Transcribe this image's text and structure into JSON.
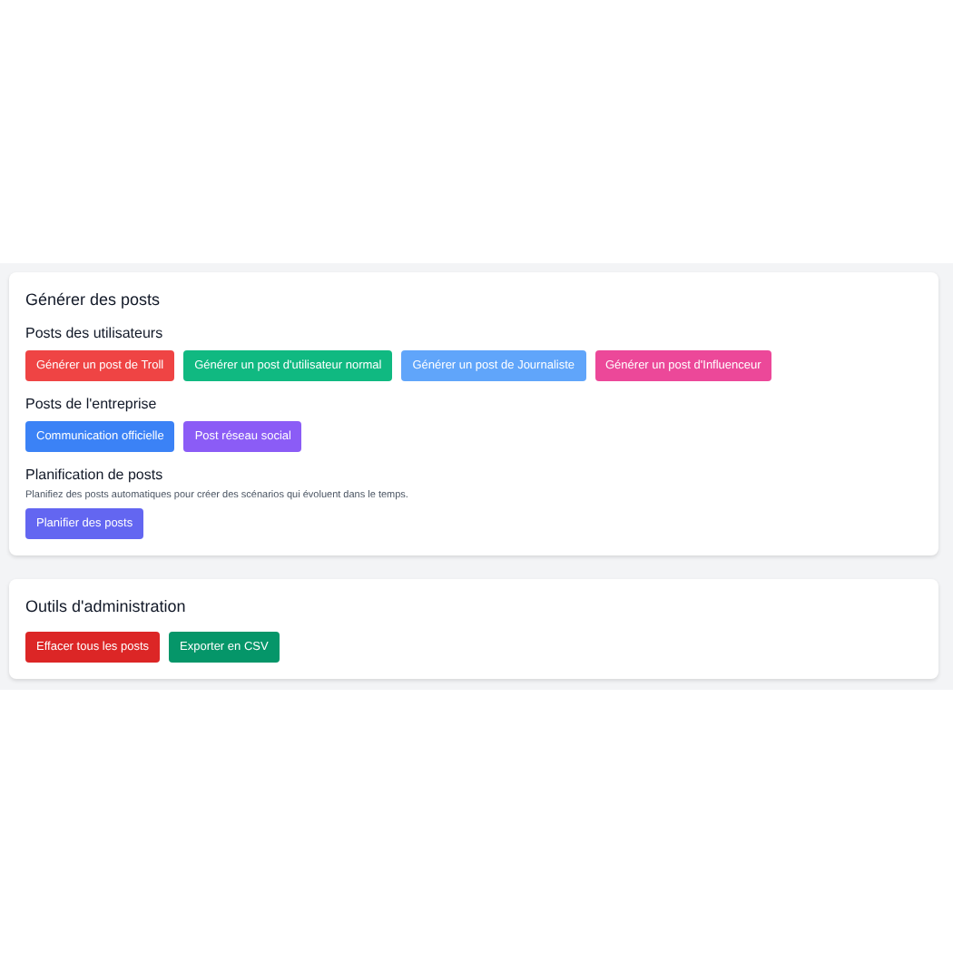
{
  "generate_card": {
    "title": "Générer des posts",
    "sections": [
      {
        "heading": "Posts des utilisateurs",
        "buttons": [
          {
            "label": "Générer un post de Troll",
            "color": "#ef4444"
          },
          {
            "label": "Générer un post d'utilisateur normal",
            "color": "#10b981"
          },
          {
            "label": "Générer un post de Journaliste",
            "color": "#60a5fa"
          },
          {
            "label": "Générer un post d'Influenceur",
            "color": "#ec4899"
          }
        ]
      },
      {
        "heading": "Posts de l'entreprise",
        "buttons": [
          {
            "label": "Communication officielle",
            "color": "#3b82f6"
          },
          {
            "label": "Post réseau social",
            "color": "#8b5cf6"
          }
        ]
      },
      {
        "heading": "Planification de posts",
        "description": "Planifiez des posts automatiques pour créer des scénarios qui évoluent dans le temps.",
        "buttons": [
          {
            "label": "Planifier des posts",
            "color": "#6366f1"
          }
        ]
      }
    ]
  },
  "admin_card": {
    "title": "Outils d'administration",
    "buttons": [
      {
        "label": "Effacer tous les posts",
        "color": "#dc2626"
      },
      {
        "label": "Exporter en CSV",
        "color": "#059669"
      }
    ]
  }
}
